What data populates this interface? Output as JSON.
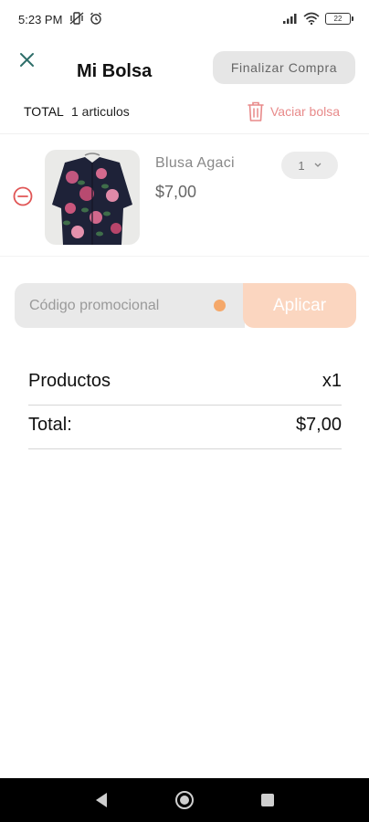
{
  "status_bar": {
    "time": "5:23 PM",
    "battery": "22",
    "icons": [
      "vibrate-icon",
      "alarm-icon",
      "signal-icon",
      "wifi-icon",
      "battery-icon"
    ]
  },
  "header": {
    "title": "Mi Bolsa",
    "checkout_label": "Finalizar Compra",
    "close_icon": "close-icon"
  },
  "summary": {
    "total_label": "TOTAL",
    "item_count": "1 articulos",
    "clear_label": "Vaciar bolsa",
    "clear_icon": "trash-icon"
  },
  "cart_items": [
    {
      "name": "Blusa Agaci",
      "price": "$7,00",
      "quantity": "1",
      "remove_icon": "minus-circle-icon"
    }
  ],
  "promo": {
    "placeholder": "Código promocional",
    "apply_label": "Aplicar"
  },
  "totals": {
    "products_label": "Productos",
    "products_value": "x1",
    "total_label": "Total:",
    "total_value": "$7,00"
  },
  "colors": {
    "accent": "#f5a86a",
    "apply_button": "#fbd6c0",
    "danger": "#e05555",
    "close_icon": "#2f6f6a"
  }
}
